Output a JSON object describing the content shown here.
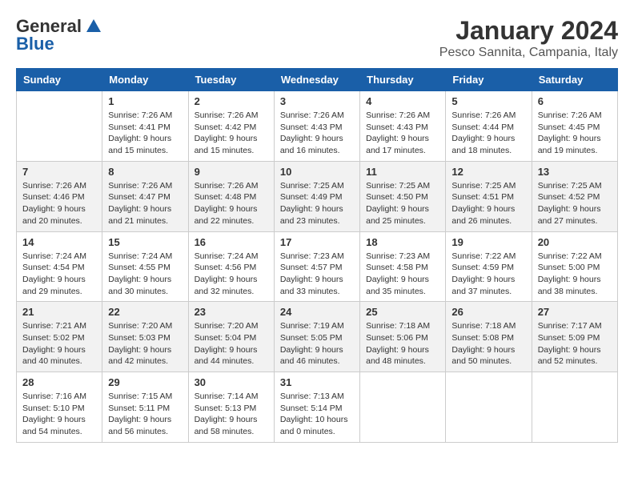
{
  "header": {
    "logo_general": "General",
    "logo_blue": "Blue",
    "month_title": "January 2024",
    "location": "Pesco Sannita, Campania, Italy"
  },
  "days_of_week": [
    "Sunday",
    "Monday",
    "Tuesday",
    "Wednesday",
    "Thursday",
    "Friday",
    "Saturday"
  ],
  "weeks": [
    {
      "shaded": false,
      "days": [
        {
          "number": "",
          "info": ""
        },
        {
          "number": "1",
          "info": "Sunrise: 7:26 AM\nSunset: 4:41 PM\nDaylight: 9 hours\nand 15 minutes."
        },
        {
          "number": "2",
          "info": "Sunrise: 7:26 AM\nSunset: 4:42 PM\nDaylight: 9 hours\nand 15 minutes."
        },
        {
          "number": "3",
          "info": "Sunrise: 7:26 AM\nSunset: 4:43 PM\nDaylight: 9 hours\nand 16 minutes."
        },
        {
          "number": "4",
          "info": "Sunrise: 7:26 AM\nSunset: 4:43 PM\nDaylight: 9 hours\nand 17 minutes."
        },
        {
          "number": "5",
          "info": "Sunrise: 7:26 AM\nSunset: 4:44 PM\nDaylight: 9 hours\nand 18 minutes."
        },
        {
          "number": "6",
          "info": "Sunrise: 7:26 AM\nSunset: 4:45 PM\nDaylight: 9 hours\nand 19 minutes."
        }
      ]
    },
    {
      "shaded": true,
      "days": [
        {
          "number": "7",
          "info": "Sunrise: 7:26 AM\nSunset: 4:46 PM\nDaylight: 9 hours\nand 20 minutes."
        },
        {
          "number": "8",
          "info": "Sunrise: 7:26 AM\nSunset: 4:47 PM\nDaylight: 9 hours\nand 21 minutes."
        },
        {
          "number": "9",
          "info": "Sunrise: 7:26 AM\nSunset: 4:48 PM\nDaylight: 9 hours\nand 22 minutes."
        },
        {
          "number": "10",
          "info": "Sunrise: 7:25 AM\nSunset: 4:49 PM\nDaylight: 9 hours\nand 23 minutes."
        },
        {
          "number": "11",
          "info": "Sunrise: 7:25 AM\nSunset: 4:50 PM\nDaylight: 9 hours\nand 25 minutes."
        },
        {
          "number": "12",
          "info": "Sunrise: 7:25 AM\nSunset: 4:51 PM\nDaylight: 9 hours\nand 26 minutes."
        },
        {
          "number": "13",
          "info": "Sunrise: 7:25 AM\nSunset: 4:52 PM\nDaylight: 9 hours\nand 27 minutes."
        }
      ]
    },
    {
      "shaded": false,
      "days": [
        {
          "number": "14",
          "info": "Sunrise: 7:24 AM\nSunset: 4:54 PM\nDaylight: 9 hours\nand 29 minutes."
        },
        {
          "number": "15",
          "info": "Sunrise: 7:24 AM\nSunset: 4:55 PM\nDaylight: 9 hours\nand 30 minutes."
        },
        {
          "number": "16",
          "info": "Sunrise: 7:24 AM\nSunset: 4:56 PM\nDaylight: 9 hours\nand 32 minutes."
        },
        {
          "number": "17",
          "info": "Sunrise: 7:23 AM\nSunset: 4:57 PM\nDaylight: 9 hours\nand 33 minutes."
        },
        {
          "number": "18",
          "info": "Sunrise: 7:23 AM\nSunset: 4:58 PM\nDaylight: 9 hours\nand 35 minutes."
        },
        {
          "number": "19",
          "info": "Sunrise: 7:22 AM\nSunset: 4:59 PM\nDaylight: 9 hours\nand 37 minutes."
        },
        {
          "number": "20",
          "info": "Sunrise: 7:22 AM\nSunset: 5:00 PM\nDaylight: 9 hours\nand 38 minutes."
        }
      ]
    },
    {
      "shaded": true,
      "days": [
        {
          "number": "21",
          "info": "Sunrise: 7:21 AM\nSunset: 5:02 PM\nDaylight: 9 hours\nand 40 minutes."
        },
        {
          "number": "22",
          "info": "Sunrise: 7:20 AM\nSunset: 5:03 PM\nDaylight: 9 hours\nand 42 minutes."
        },
        {
          "number": "23",
          "info": "Sunrise: 7:20 AM\nSunset: 5:04 PM\nDaylight: 9 hours\nand 44 minutes."
        },
        {
          "number": "24",
          "info": "Sunrise: 7:19 AM\nSunset: 5:05 PM\nDaylight: 9 hours\nand 46 minutes."
        },
        {
          "number": "25",
          "info": "Sunrise: 7:18 AM\nSunset: 5:06 PM\nDaylight: 9 hours\nand 48 minutes."
        },
        {
          "number": "26",
          "info": "Sunrise: 7:18 AM\nSunset: 5:08 PM\nDaylight: 9 hours\nand 50 minutes."
        },
        {
          "number": "27",
          "info": "Sunrise: 7:17 AM\nSunset: 5:09 PM\nDaylight: 9 hours\nand 52 minutes."
        }
      ]
    },
    {
      "shaded": false,
      "days": [
        {
          "number": "28",
          "info": "Sunrise: 7:16 AM\nSunset: 5:10 PM\nDaylight: 9 hours\nand 54 minutes."
        },
        {
          "number": "29",
          "info": "Sunrise: 7:15 AM\nSunset: 5:11 PM\nDaylight: 9 hours\nand 56 minutes."
        },
        {
          "number": "30",
          "info": "Sunrise: 7:14 AM\nSunset: 5:13 PM\nDaylight: 9 hours\nand 58 minutes."
        },
        {
          "number": "31",
          "info": "Sunrise: 7:13 AM\nSunset: 5:14 PM\nDaylight: 10 hours\nand 0 minutes."
        },
        {
          "number": "",
          "info": ""
        },
        {
          "number": "",
          "info": ""
        },
        {
          "number": "",
          "info": ""
        }
      ]
    }
  ]
}
